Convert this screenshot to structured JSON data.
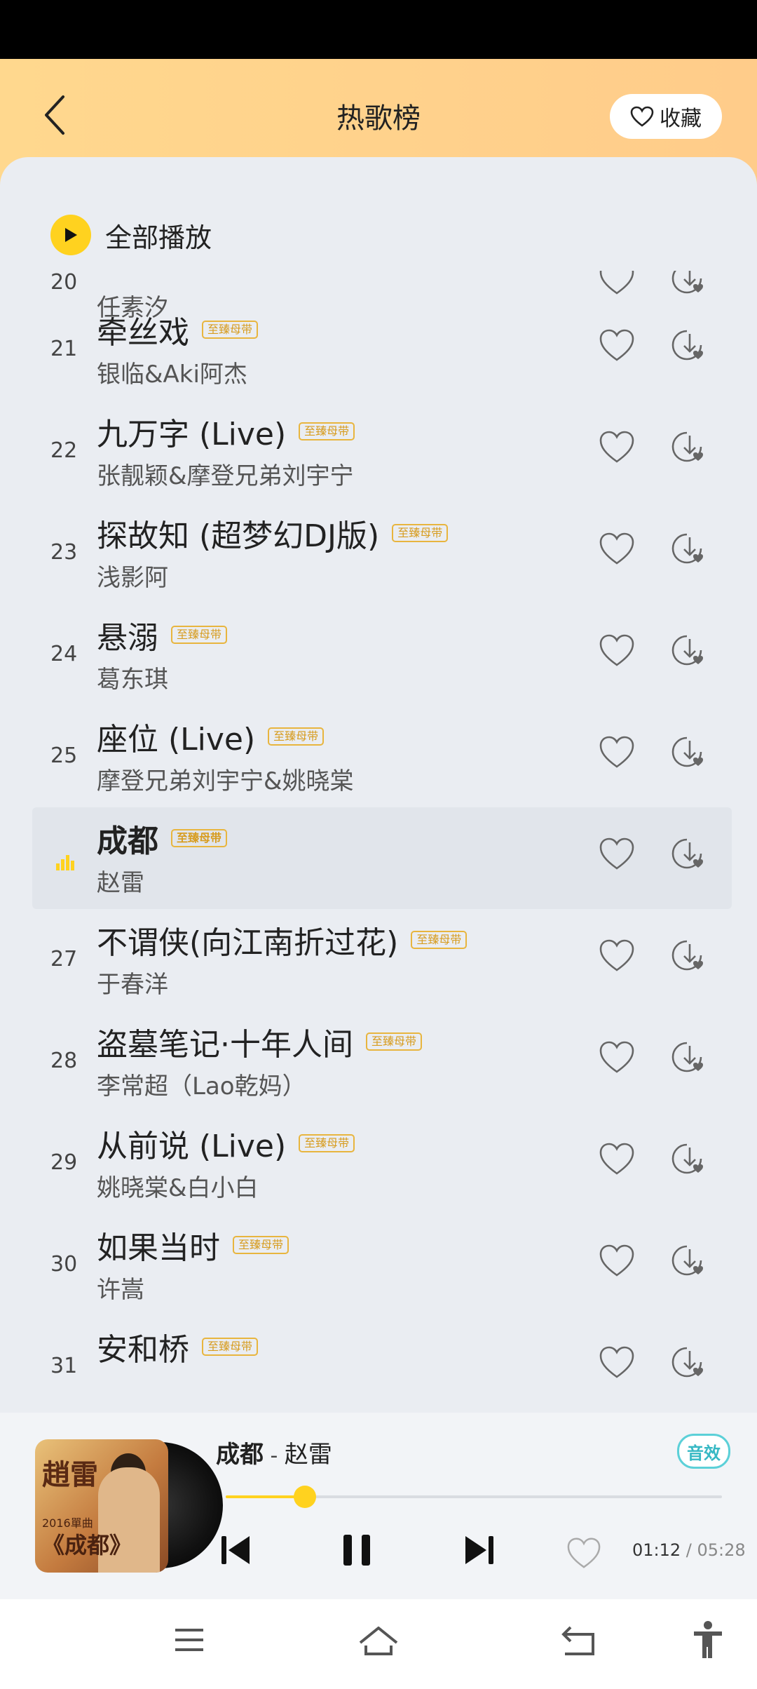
{
  "header": {
    "title": "热歌榜",
    "collect_label": "收藏"
  },
  "play_all_label": "全部播放",
  "songs": [
    {
      "rank": "20",
      "title": "",
      "badge": "",
      "artist": "任素汐"
    },
    {
      "rank": "21",
      "title": "牵丝戏",
      "badge": "至臻母带",
      "artist": "银临&Aki阿杰"
    },
    {
      "rank": "22",
      "title": "九万字 (Live)",
      "badge": "至臻母带",
      "artist": "张靓颖&摩登兄弟刘宇宁"
    },
    {
      "rank": "23",
      "title": "探故知 (超梦幻DJ版)",
      "badge": "至臻母带",
      "artist": "浅影阿"
    },
    {
      "rank": "24",
      "title": "悬溺",
      "badge": "至臻母带",
      "artist": "葛东琪"
    },
    {
      "rank": "25",
      "title": "座位 (Live)",
      "badge": "至臻母带",
      "artist": "摩登兄弟刘宇宁&姚晓棠"
    },
    {
      "rank": "",
      "title": "成都",
      "badge": "至臻母带",
      "artist": "赵雷",
      "playing": true
    },
    {
      "rank": "27",
      "title": "不谓侠(向江南折过花)",
      "badge": "至臻母带",
      "artist": "于春洋"
    },
    {
      "rank": "28",
      "title": "盗墓笔记·十年人间",
      "badge": "至臻母带",
      "artist": "李常超（Lao乾妈）"
    },
    {
      "rank": "29",
      "title": "从前说 (Live)",
      "badge": "至臻母带",
      "artist": "姚晓棠&白小白"
    },
    {
      "rank": "30",
      "title": "如果当时",
      "badge": "至臻母带",
      "artist": "许嵩"
    },
    {
      "rank": "31",
      "title": "安和桥",
      "badge": "至臻母带",
      "artist": ""
    }
  ],
  "player": {
    "song": "成都",
    "separator": " - ",
    "artist": "赵雷",
    "effect_label": "音效",
    "progress_fraction": 0.16,
    "current_time": "01:12",
    "total_time": "05:28",
    "cover": {
      "line1": "趙雷",
      "line2": "2016單曲",
      "line3": "《成都》"
    }
  },
  "colors": {
    "accent": "#ffd21f",
    "header_start": "#ffd88e",
    "header_end": "#ffcc8a",
    "effect": "#36b8c4",
    "badge": "#d79c1f"
  }
}
